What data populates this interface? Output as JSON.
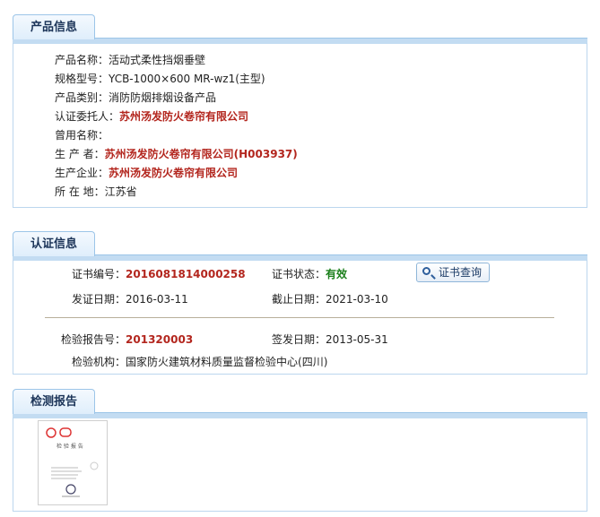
{
  "product": {
    "tab": "产品信息",
    "rows": [
      {
        "label": "产品名称：",
        "value": "活动式柔性挡烟垂壁",
        "style": "normal"
      },
      {
        "label": "规格型号：",
        "value": "YCB-1000×600 MR-wz1(主型)",
        "style": "normal"
      },
      {
        "label": "产品类别：",
        "value": "消防防烟排烟设备产品",
        "style": "normal"
      },
      {
        "label": "认证委托人：",
        "value": "苏州汤发防火卷帘有限公司",
        "style": "red"
      },
      {
        "label": "曾用名称：",
        "value": "",
        "style": "normal"
      },
      {
        "label": "生 产 者：",
        "value": "苏州汤发防火卷帘有限公司(H003937)",
        "style": "red"
      },
      {
        "label": "生产企业：",
        "value": "苏州汤发防火卷帘有限公司",
        "style": "red"
      },
      {
        "label": "所 在 地：",
        "value": "江苏省",
        "style": "normal"
      }
    ]
  },
  "cert": {
    "tab": "认证信息",
    "cert_no_label": "证书编号：",
    "cert_no": "2016081814000258",
    "status_label": "证书状态：",
    "status": "有效",
    "query_button": "证书查询",
    "issue_label": "发证日期：",
    "issue_date": "2016-03-11",
    "expire_label": "截止日期：",
    "expire_date": "2021-03-10",
    "report_no_label": "检验报告号：",
    "report_no": "201320003",
    "sign_label": "签发日期：",
    "sign_date": "2013-05-31",
    "org_label": "检验机构：",
    "org": "国家防火建筑材料质量监督检验中心(四川)"
  },
  "report": {
    "tab": "检测报告",
    "thumb_title": "检 验 报 告"
  }
}
